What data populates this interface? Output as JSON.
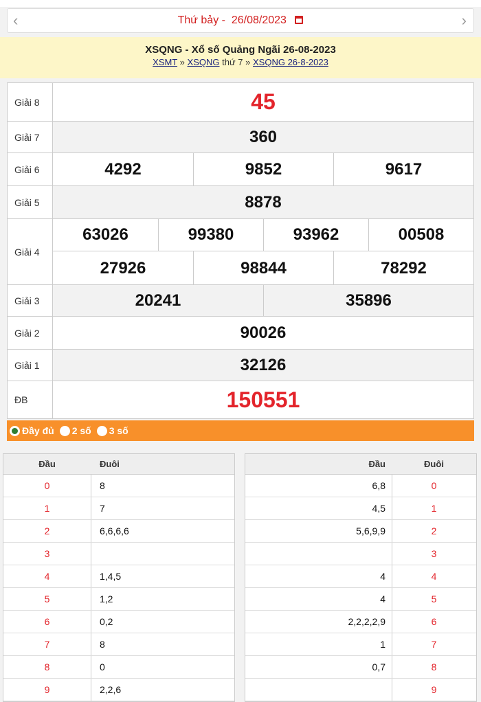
{
  "date_bar": {
    "prev": "‹",
    "next": "›",
    "weekday": "Thứ bảy -",
    "date": "26/08/2023"
  },
  "header": {
    "title": "XSQNG - Xổ số Quảng Ngãi 26-08-2023",
    "crumb1": "XSMT",
    "sep": "»",
    "crumb2": "XSQNG",
    "crumb2_suffix": "thứ 7",
    "crumb3": "XSQNG 26-8-2023"
  },
  "results": {
    "g8": {
      "label": "Giải 8",
      "values": [
        "45"
      ]
    },
    "g7": {
      "label": "Giải 7",
      "values": [
        "360"
      ]
    },
    "g6": {
      "label": "Giải 6",
      "values": [
        "4292",
        "9852",
        "9617"
      ]
    },
    "g5": {
      "label": "Giải 5",
      "values": [
        "8878"
      ]
    },
    "g4": {
      "label": "Giải 4",
      "values": [
        "63026",
        "99380",
        "93962",
        "00508",
        "27926",
        "98844",
        "78292"
      ]
    },
    "g3": {
      "label": "Giải 3",
      "values": [
        "20241",
        "35896"
      ]
    },
    "g2": {
      "label": "Giải 2",
      "values": [
        "90026"
      ]
    },
    "g1": {
      "label": "Giải 1",
      "values": [
        "32126"
      ]
    },
    "db": {
      "label": "ĐB",
      "values": [
        "150551"
      ]
    }
  },
  "filter": {
    "full": "Đầy đủ",
    "two": "2 số",
    "three": "3 số"
  },
  "loto_left": {
    "h_dau": "Đầu",
    "h_duoi": "Đuôi",
    "rows": [
      [
        "0",
        "8"
      ],
      [
        "1",
        "7"
      ],
      [
        "2",
        "6,6,6,6"
      ],
      [
        "3",
        ""
      ],
      [
        "4",
        "1,4,5"
      ],
      [
        "5",
        "1,2"
      ],
      [
        "6",
        "0,2"
      ],
      [
        "7",
        "8"
      ],
      [
        "8",
        "0"
      ],
      [
        "9",
        "2,2,6"
      ]
    ]
  },
  "loto_right": {
    "h_dau": "Đầu",
    "h_duoi": "Đuôi",
    "rows": [
      [
        "6,8",
        "0"
      ],
      [
        "4,5",
        "1"
      ],
      [
        "5,6,9,9",
        "2"
      ],
      [
        "",
        "3"
      ],
      [
        "4",
        "4"
      ],
      [
        "4",
        "5"
      ],
      [
        "2,2,2,2,9",
        "6"
      ],
      [
        "1",
        "7"
      ],
      [
        "0,7",
        "8"
      ],
      [
        "",
        "9"
      ]
    ]
  },
  "colors": {
    "accent_red": "#e3242b",
    "filter_orange": "#f8902a",
    "header_yellow": "#fdf6c8"
  }
}
